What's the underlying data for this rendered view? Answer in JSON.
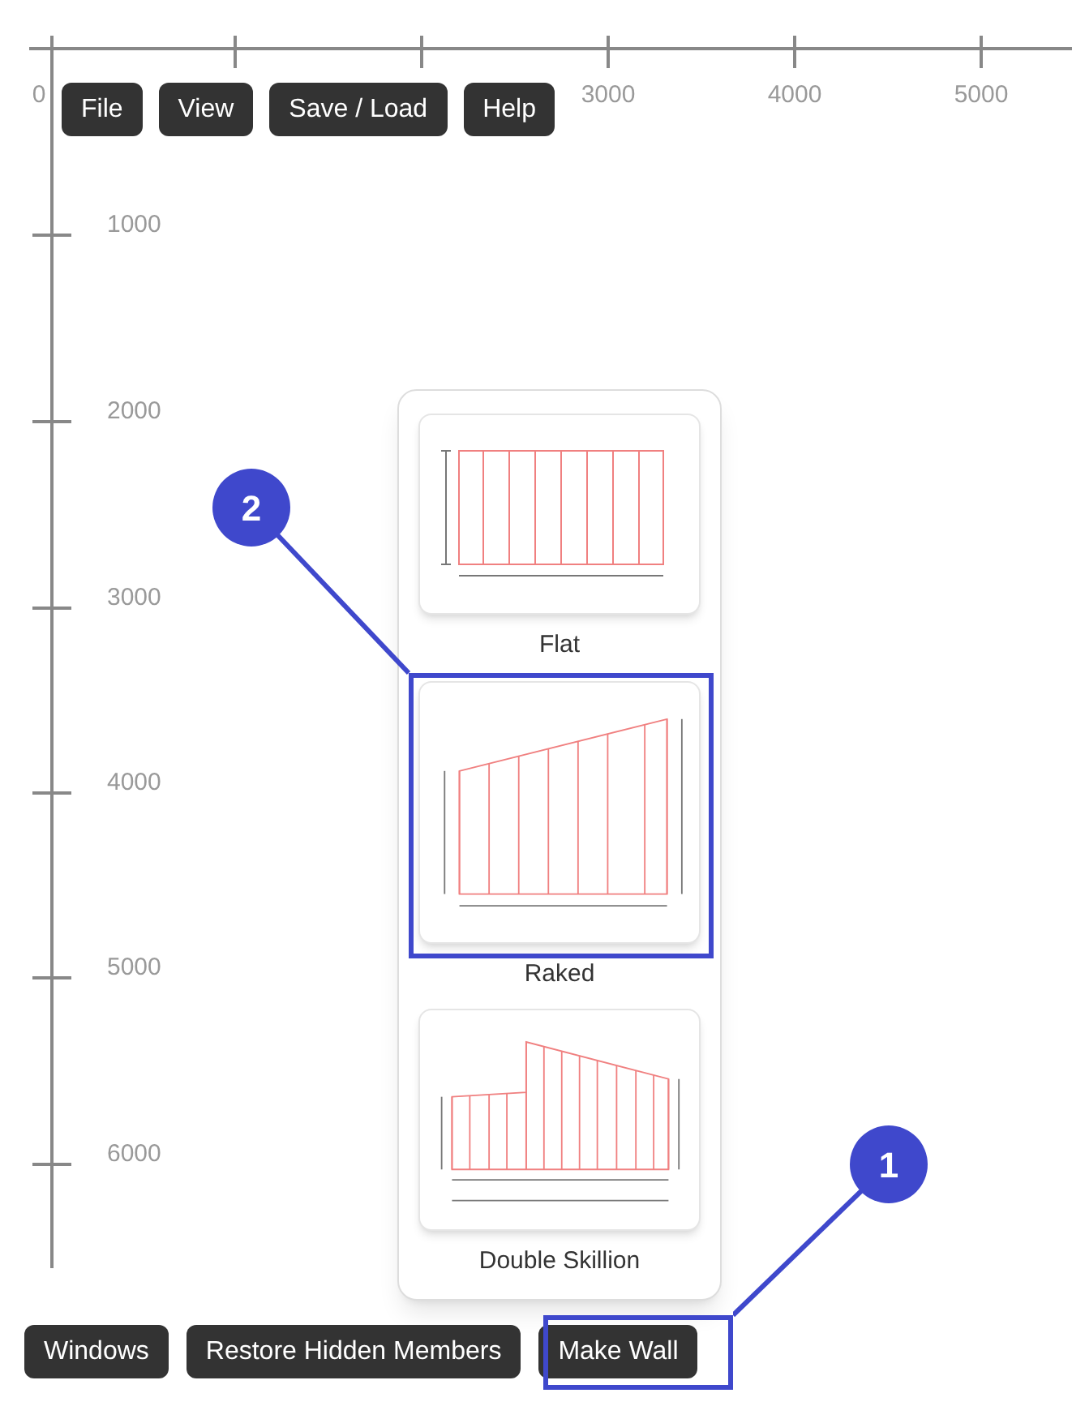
{
  "x_axis": {
    "labels": [
      "0",
      "3000",
      "4000",
      "5000"
    ]
  },
  "y_axis": {
    "labels": [
      "1000",
      "2000",
      "3000",
      "4000",
      "5000",
      "6000"
    ]
  },
  "top_menu": [
    "File",
    "View",
    "Save / Load",
    "Help"
  ],
  "wall_menu": {
    "options": [
      {
        "kind": "flat",
        "label": "Flat"
      },
      {
        "kind": "raked",
        "label": "Raked"
      },
      {
        "kind": "double_skillion",
        "label": "Double Skillion"
      }
    ]
  },
  "bottom_buttons": [
    "Windows",
    "Restore Hidden Members",
    "Make Wall"
  ],
  "callouts": [
    {
      "number": "1"
    },
    {
      "number": "2"
    }
  ]
}
